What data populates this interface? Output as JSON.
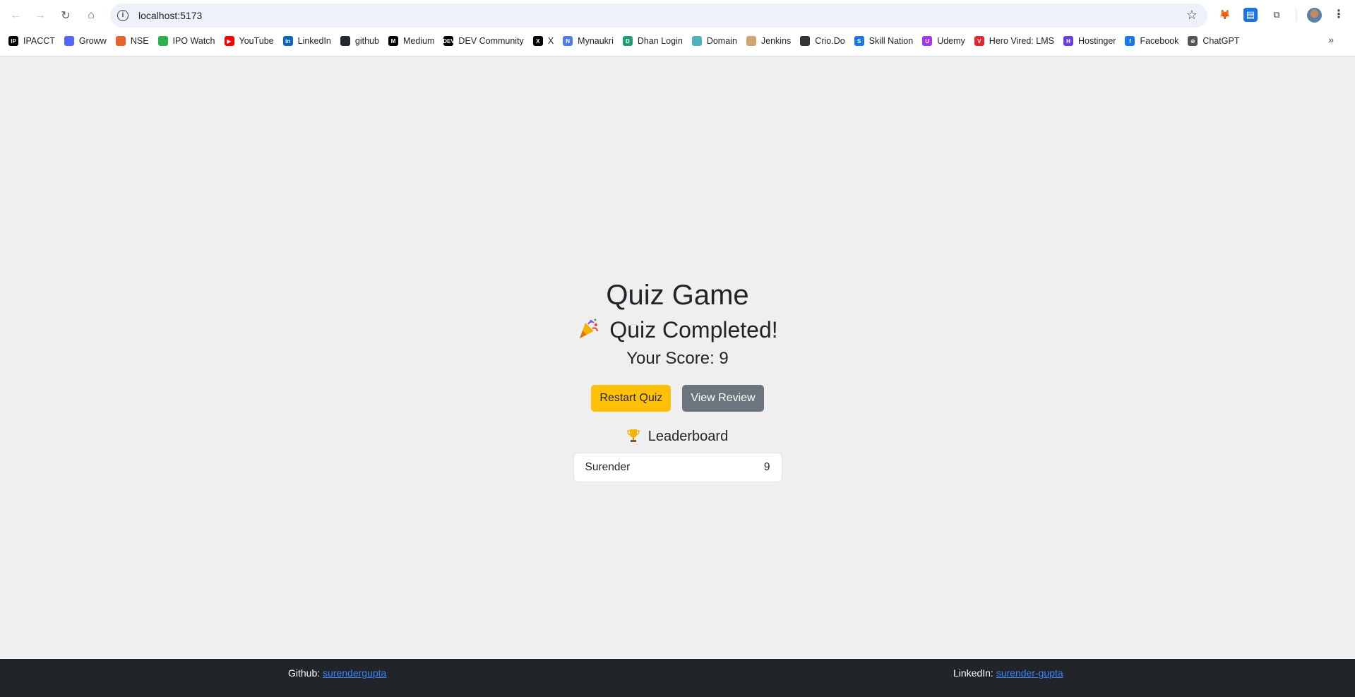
{
  "browser": {
    "url": "localhost:5173",
    "bookmarks": [
      {
        "label": "IPACCT",
        "icon": "ipacct-icon",
        "color": "#000000",
        "glyph": "IP"
      },
      {
        "label": "Groww",
        "icon": "groww-icon",
        "color": "#5367ff",
        "glyph": ""
      },
      {
        "label": "NSE",
        "icon": "nse-icon",
        "color": "#e8622c",
        "glyph": ""
      },
      {
        "label": "IPO Watch",
        "icon": "ipo-watch-icon",
        "color": "#2bb24c",
        "glyph": ""
      },
      {
        "label": "YouTube",
        "icon": "youtube-icon",
        "color": "#ff0000",
        "glyph": "▶"
      },
      {
        "label": "LinkedIn",
        "icon": "linkedin-icon",
        "color": "#0a66c2",
        "glyph": "in"
      },
      {
        "label": "github",
        "icon": "github-icon",
        "color": "#24292f",
        "glyph": ""
      },
      {
        "label": "Medium",
        "icon": "medium-icon",
        "color": "#000000",
        "glyph": "M"
      },
      {
        "label": "DEV Community",
        "icon": "dev-icon",
        "color": "#000000",
        "glyph": "DEV"
      },
      {
        "label": "X",
        "icon": "x-icon",
        "color": "#000000",
        "glyph": "X"
      },
      {
        "label": "Mynaukri",
        "icon": "mynaukri-icon",
        "color": "#4a7cf7",
        "glyph": "N"
      },
      {
        "label": "Dhan Login",
        "icon": "dhan-icon",
        "color": "#1e9e74",
        "glyph": "D"
      },
      {
        "label": "Domain",
        "icon": "domain-icon",
        "color": "#4fb3bf",
        "glyph": ""
      },
      {
        "label": "Jenkins",
        "icon": "jenkins-icon",
        "color": "#d4a373",
        "glyph": ""
      },
      {
        "label": "Crio.Do",
        "icon": "crio-icon",
        "color": "#333333",
        "glyph": ""
      },
      {
        "label": "Skill Nation",
        "icon": "skill-nation-icon",
        "color": "#1a73e8",
        "glyph": "S"
      },
      {
        "label": "Udemy",
        "icon": "udemy-icon",
        "color": "#a435f0",
        "glyph": "U"
      },
      {
        "label": "Hero Vired: LMS",
        "icon": "hero-vired-icon",
        "color": "#e3262f",
        "glyph": "V"
      },
      {
        "label": "Hostinger",
        "icon": "hostinger-icon",
        "color": "#673de6",
        "glyph": "H"
      },
      {
        "label": "Facebook",
        "icon": "facebook-icon",
        "color": "#1877f2",
        "glyph": "f"
      },
      {
        "label": "ChatGPT",
        "icon": "chatgpt-icon",
        "color": "#555555",
        "glyph": "⊛"
      }
    ]
  },
  "quiz": {
    "title": "Quiz Game",
    "completed_heading": "Quiz Completed!",
    "score_text": "Your Score: 9",
    "restart_label": "Restart Quiz",
    "review_label": "View Review",
    "leaderboard_title": "Leaderboard",
    "leaderboard": [
      {
        "name": "Surender",
        "score": "9"
      }
    ]
  },
  "footer": {
    "github_label": "Github:",
    "github_link": "surendergupta",
    "linkedin_label": "LinkedIn:",
    "linkedin_link": "surender-gupta"
  },
  "colors": {
    "page_bg": "#efefef",
    "restart_button": "#ffc107",
    "review_button": "#6c757d",
    "footer_bg": "#212529",
    "link": "#3b82f6"
  }
}
